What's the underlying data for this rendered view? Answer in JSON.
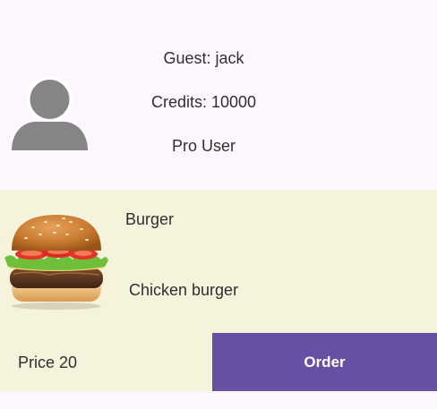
{
  "user": {
    "guest_label": "Guest: jack",
    "credits_label": "Credits: 10000",
    "tier_label": "Pro User",
    "avatar_icon": "person-avatar-icon"
  },
  "item": {
    "name": "Burger",
    "description": "Chicken burger",
    "price_label": "Price 20",
    "order_label": "Order",
    "image_icon": "burger-image"
  },
  "colors": {
    "background": "#fdf7fd",
    "card_background": "#f5f3db",
    "accent": "#674fa3",
    "avatar_gray": "#858585"
  }
}
